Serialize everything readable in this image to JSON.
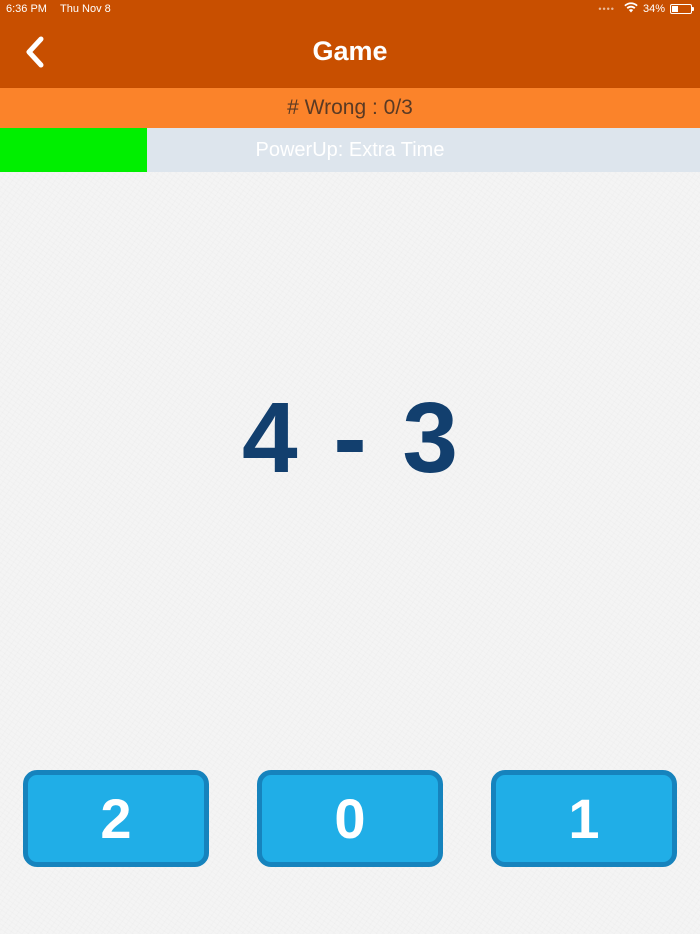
{
  "status_bar": {
    "time": "6:36 PM",
    "date": "Thu Nov 8",
    "battery": "34%",
    "battery_level": 0.34
  },
  "nav": {
    "title": "Game",
    "back_icon": "chevron-left-icon"
  },
  "wrong_counter": {
    "text": "# Wrong : 0/3"
  },
  "powerup": {
    "label": "PowerUp: Extra Time",
    "progress": 0.21,
    "fill_color": "#00ef00"
  },
  "question": {
    "text": "4 - 3"
  },
  "answers": [
    {
      "label": "2"
    },
    {
      "label": "0"
    },
    {
      "label": "1"
    }
  ],
  "colors": {
    "nav_bg": "#c84f00",
    "wrong_bar_bg": "#fb832a",
    "question_text": "#123f6e",
    "answer_bg": "#20aee7",
    "answer_border": "#1683bd"
  }
}
